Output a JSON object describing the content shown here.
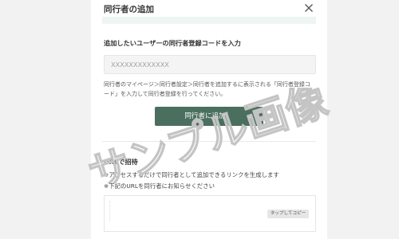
{
  "modal": {
    "title": "同行者の追加"
  },
  "code_section": {
    "label": "追加したいユーザーの同行者登録コードを入力",
    "placeholder": "XXXXXXXXXXXXX",
    "help_text": "同行者のマイページ＞同行者設定＞同行者を追加するに表示される「同行者登録コード」を入力して同行者登録を行ってください。",
    "submit_label": "同行者に追加"
  },
  "url_section": {
    "label": "URLで招待",
    "note_1": "※アクセスするだけで同行者として追加できるリンクを生成します",
    "note_2": "※下記のURLを同行者にお知らせください",
    "copy_label": "タップしてコピー"
  },
  "watermark": {
    "text": "サンプル画像"
  },
  "colors": {
    "accent_button": "#4a6f5f",
    "header_band": "#eef5f3",
    "watermark": "#cccccc"
  }
}
